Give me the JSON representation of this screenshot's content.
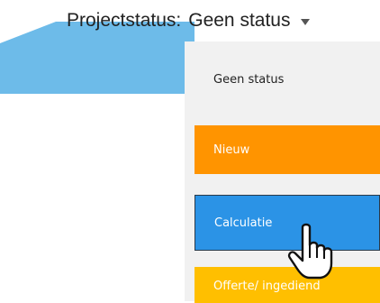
{
  "project_status": {
    "label": "Projectstatus:",
    "selected_value": "Geen status",
    "options": [
      {
        "label": "Geen status",
        "color": ""
      },
      {
        "label": "Nieuw",
        "color": "#ff9400"
      },
      {
        "label": "Calculatie",
        "color": "#2b93e6"
      },
      {
        "label": "Offerte/ ingediend",
        "color": "#ffbf00"
      }
    ]
  },
  "header_accent_color": "#6dbbe9",
  "cursor_icon": "pointing-hand-icon"
}
